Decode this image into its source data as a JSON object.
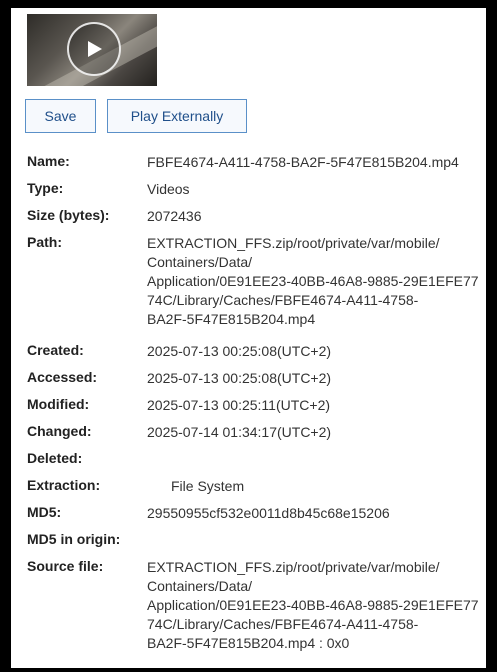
{
  "toolbar": {
    "save_label": "Save",
    "play_externally_label": "Play Externally"
  },
  "thumbnail": {
    "icon": "play-icon"
  },
  "details": [
    {
      "label": "Name:",
      "value": "FBFE4674-A411-4758-BA2F-5F47E815B204.mp4"
    },
    {
      "label": "Type:",
      "value": "Videos"
    },
    {
      "label": "Size (bytes):",
      "value": "2072436"
    },
    {
      "label": "Path:",
      "value": "EXTRACTION_FFS.zip/root/private/var/mobile/\nContainers/Data/\nApplication/0E91EE23-40BB-46A8-9885-29E1EFE77\n74C/Library/Caches/FBFE4674-A411-4758-\nBA2F-5F47E815B204.mp4"
    },
    {
      "label": "Created:",
      "value": "2025-07-13 00:25:08(UTC+2)"
    },
    {
      "label": "Accessed:",
      "value": "2025-07-13 00:25:08(UTC+2)"
    },
    {
      "label": "Modified:",
      "value": "2025-07-13 00:25:11(UTC+2)"
    },
    {
      "label": "Changed:",
      "value": "2025-07-14 01:34:17(UTC+2)"
    },
    {
      "label": "Deleted:",
      "value": ""
    },
    {
      "label": "Extraction:",
      "value": "File System"
    },
    {
      "label": "MD5:",
      "value": "29550955cf532e0011d8b45c68e15206"
    },
    {
      "label": "MD5 in origin:",
      "value": ""
    },
    {
      "label": "Source file:",
      "value": "EXTRACTION_FFS.zip/root/private/var/mobile/\nContainers/Data/\nApplication/0E91EE23-40BB-46A8-9885-29E1EFE77\n74C/Library/Caches/FBFE4674-A411-4758-\nBA2F-5F47E815B204.mp4 : 0x0"
    }
  ]
}
